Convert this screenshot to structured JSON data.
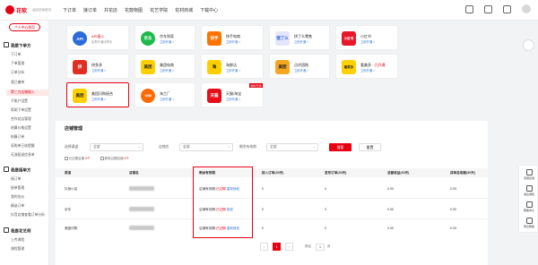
{
  "brand": {
    "name": "花软",
    "subtitle": "返回旧版首页"
  },
  "nav": [
    "下订单",
    "接订单",
    "共花店",
    "花鼓物图",
    "花艺学院",
    "花材商城",
    "下载中心"
  ],
  "sidebar": {
    "personal_center_button": "个人中心首页",
    "groups": [
      {
        "label": "我是下单方",
        "items": [
          "下订单",
          "下单管理",
          "订单分析",
          "我已撤单",
          "第三方店铺接入",
          "子账户设置",
          "帮助下单设置",
          "合作花店管理",
          "结算价格设置",
          "结算订单",
          "采购单已核提醒",
          "无流配送信息单"
        ]
      },
      {
        "label": "我是接单方",
        "items": [
          "接订单",
          "接单管理",
          "我的估价",
          "精选订单",
          "抖音店铺查看订单分析"
        ]
      },
      {
        "label": "我是花艺师",
        "items": [
          "上传课程",
          "课程管理"
        ]
      }
    ],
    "active_item": "第三方店铺接入"
  },
  "platforms": [
    {
      "name": "API接入",
      "status": "已开通",
      "sub": "如需开通请联系",
      "logo": "API",
      "color": "#2d6bdb",
      "name_red": true
    },
    {
      "name": "京东到家",
      "status": "立即开通 >",
      "logo": "京东",
      "color": "#1db94a"
    },
    {
      "name": "快手电商",
      "status": "立即开通 >",
      "logo": "快手",
      "color": "#ff7300"
    },
    {
      "name": "拼了么零售",
      "status": "立即开通 >",
      "logo": "饿了么",
      "color": "#e5e5ff"
    },
    {
      "name": "小红书",
      "status": "立即开通 >",
      "logo": "小红书",
      "color": "#e8182b"
    },
    {
      "name": "拼多多",
      "status": "立即开通 >",
      "logo": "拼",
      "color": "#e02e24"
    },
    {
      "name": "美团电商",
      "status": "立即开通 >",
      "logo": "美团",
      "color": "#ffd000"
    },
    {
      "name": "淘鲜达",
      "status": "立即开通 >",
      "logo": "淘",
      "color": "#ffce00"
    },
    {
      "name": "点评团购",
      "status": "立即开通 >",
      "logo": "美团",
      "color": "#f5a623"
    },
    {
      "name": "看美多",
      "status": "已开通",
      "sub": "立即开通 >",
      "logo": "看美多",
      "color": "#ffd100",
      "name_red": true
    },
    {
      "name": "美团闪购接合",
      "status": "立即开通 >",
      "logo": "美团",
      "color": "#ffd000",
      "selected": true
    },
    {
      "name": "淘工厂",
      "status": "立即开通 >",
      "logo": "1688",
      "color": "#ff6a00"
    },
    {
      "name": "天猫/淘宝",
      "status": "立即开通 >",
      "logo": "天猫",
      "color": "#e80e19",
      "badge": "限时开通"
    }
  ],
  "shop": {
    "title": "店铺管理",
    "filters": {
      "platform_label": "选择渠道",
      "platform_value": "全部",
      "store_label": "店铺名",
      "store_value": "全部",
      "expiry_label": "剩余有效期",
      "expiry_value": "全部",
      "search": "搜索",
      "reset": "重置"
    },
    "checks": [
      {
        "label": "已过期店铺",
        "count": "0个"
      },
      {
        "label": "即将过期店铺",
        "count": "0个"
      }
    ],
    "columns": [
      "渠道",
      "店铺名",
      "剩余有效期",
      "接入订单(30天)",
      "发布订单(30天)",
      "总额收益(30天)",
      "成单总收额(30天)"
    ],
    "rows": [
      {
        "channel": "抖音小店",
        "status": "已过期",
        "action": "重新授权",
        "prefix": "店铺有效期:",
        "vals": [
          "0",
          "0",
          "0.00",
          "0.00"
        ]
      },
      {
        "channel": "京东",
        "status": "已过期",
        "action": "授权",
        "prefix": "店铺有效期:",
        "vals": [
          "0",
          "0",
          "0.00",
          "0.00"
        ]
      },
      {
        "channel": "美团闪购",
        "status": "已过期",
        "action": "重新授权",
        "prefix": "店铺有效期:",
        "vals": [
          "0",
          "0",
          "0.00",
          "0.00"
        ]
      }
    ],
    "pager": {
      "current": "1",
      "goto": "前往",
      "page": "1",
      "unit": "页"
    }
  },
  "right_rail": [
    "问题反馈",
    "消息通知",
    "帮助中心",
    "意见帮助"
  ],
  "colors": {
    "accent": "#e60012",
    "link": "#3a7bd5"
  }
}
